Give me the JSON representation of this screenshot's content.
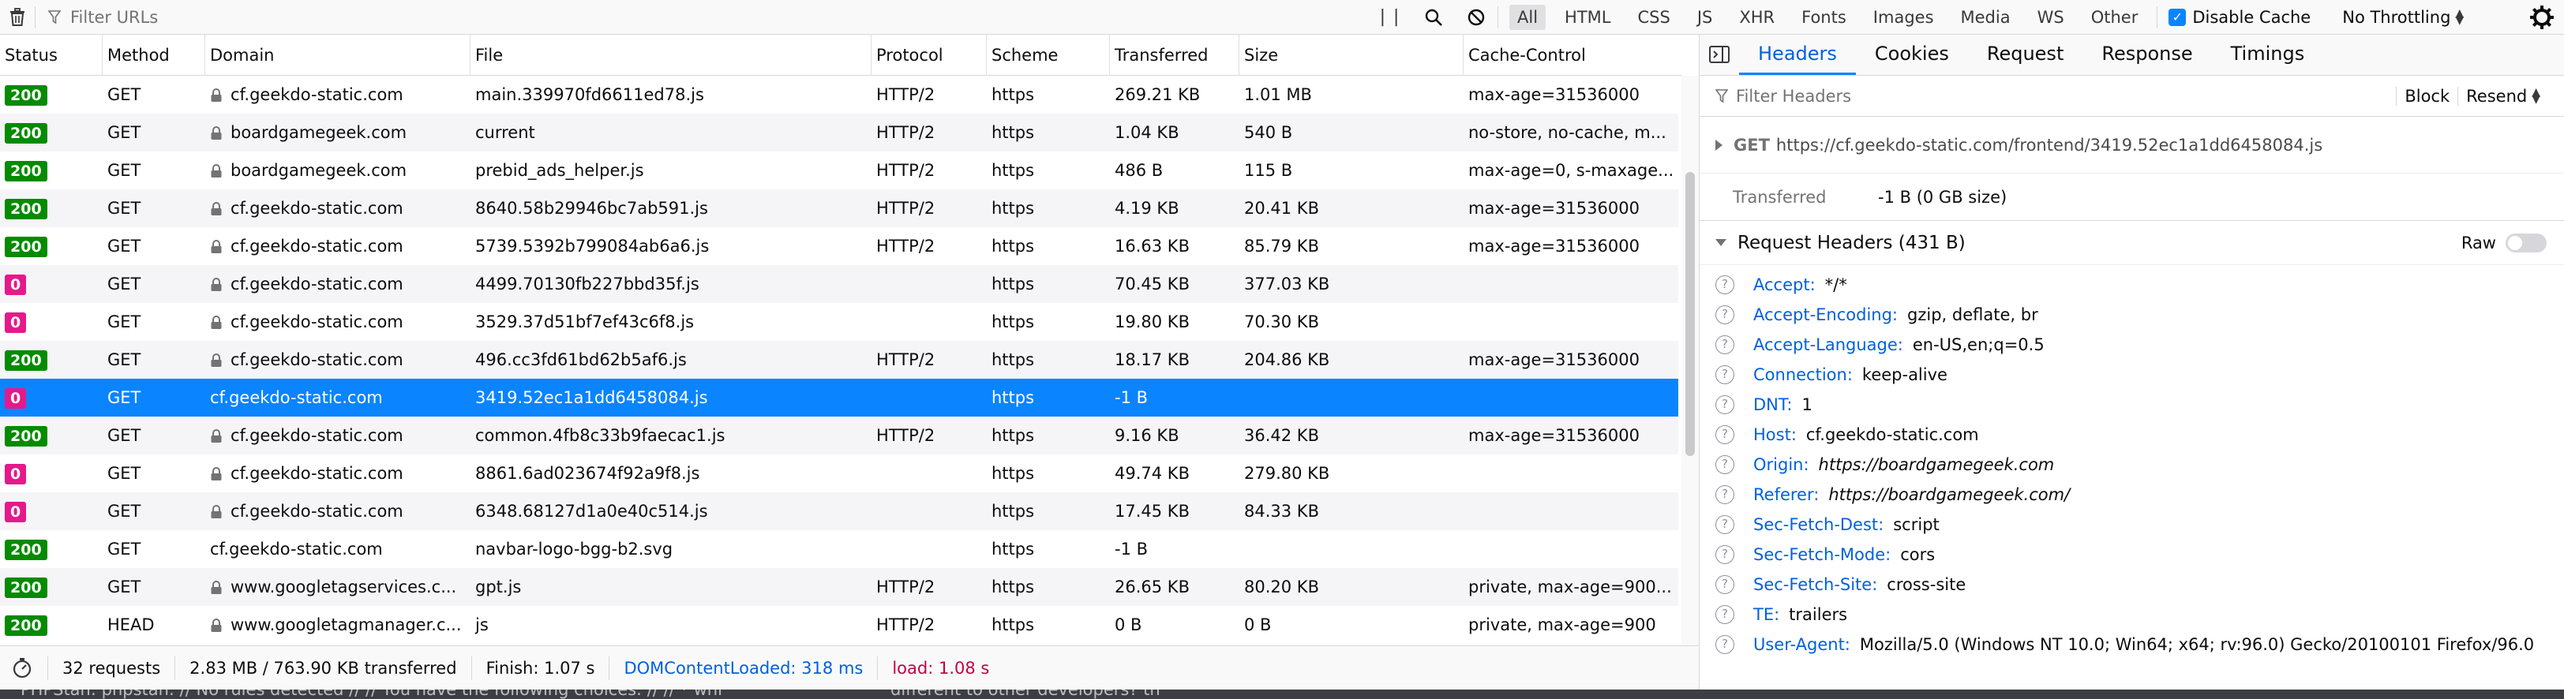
{
  "toolbar": {
    "filter_placeholder": "Filter URLs",
    "type_filters": [
      "All",
      "HTML",
      "CSS",
      "JS",
      "XHR",
      "Fonts",
      "Images",
      "Media",
      "WS",
      "Other"
    ],
    "active_filter": "All",
    "disable_cache_label": "Disable Cache",
    "disable_cache_checked": true,
    "throttling": "No Throttling"
  },
  "columns": [
    "Status",
    "Method",
    "Domain",
    "File",
    "Protocol",
    "Scheme",
    "Transferred",
    "Size",
    "Cache-Control"
  ],
  "requests": [
    {
      "status": "200",
      "method": "GET",
      "secure": true,
      "domain": "cf.geekdo-static.com",
      "file": "main.339970fd6611ed78.js",
      "protocol": "HTTP/2",
      "scheme": "https",
      "transferred": "269.21 KB",
      "size": "1.01 MB",
      "cache": "max-age=31536000"
    },
    {
      "status": "200",
      "method": "GET",
      "secure": true,
      "domain": "boardgamegeek.com",
      "file": "current",
      "protocol": "HTTP/2",
      "scheme": "https",
      "transferred": "1.04 KB",
      "size": "540 B",
      "cache": "no-store, no-cache, m..."
    },
    {
      "status": "200",
      "method": "GET",
      "secure": true,
      "domain": "boardgamegeek.com",
      "file": "prebid_ads_helper.js",
      "protocol": "HTTP/2",
      "scheme": "https",
      "transferred": "486 B",
      "size": "115 B",
      "cache": "max-age=0, s-maxage..."
    },
    {
      "status": "200",
      "method": "GET",
      "secure": true,
      "domain": "cf.geekdo-static.com",
      "file": "8640.58b29946bc7ab591.js",
      "protocol": "HTTP/2",
      "scheme": "https",
      "transferred": "4.19 KB",
      "size": "20.41 KB",
      "cache": "max-age=31536000"
    },
    {
      "status": "200",
      "method": "GET",
      "secure": true,
      "domain": "cf.geekdo-static.com",
      "file": "5739.5392b799084ab6a6.js",
      "protocol": "HTTP/2",
      "scheme": "https",
      "transferred": "16.63 KB",
      "size": "85.79 KB",
      "cache": "max-age=31536000"
    },
    {
      "status": "0",
      "method": "GET",
      "secure": true,
      "domain": "cf.geekdo-static.com",
      "file": "4499.70130fb227bbd35f.js",
      "protocol": "",
      "scheme": "https",
      "transferred": "70.45 KB",
      "size": "377.03 KB",
      "cache": ""
    },
    {
      "status": "0",
      "method": "GET",
      "secure": true,
      "domain": "cf.geekdo-static.com",
      "file": "3529.37d51bf7ef43c6f8.js",
      "protocol": "",
      "scheme": "https",
      "transferred": "19.80 KB",
      "size": "70.30 KB",
      "cache": ""
    },
    {
      "status": "200",
      "method": "GET",
      "secure": true,
      "domain": "cf.geekdo-static.com",
      "file": "496.cc3fd61bd62b5af6.js",
      "protocol": "HTTP/2",
      "scheme": "https",
      "transferred": "18.17 KB",
      "size": "204.86 KB",
      "cache": "max-age=31536000"
    },
    {
      "status": "0",
      "method": "GET",
      "secure": false,
      "domain": "cf.geekdo-static.com",
      "file": "3419.52ec1a1dd6458084.js",
      "protocol": "",
      "scheme": "https",
      "transferred": "-1 B",
      "size": "",
      "cache": "",
      "selected": true
    },
    {
      "status": "200",
      "method": "GET",
      "secure": true,
      "domain": "cf.geekdo-static.com",
      "file": "common.4fb8c33b9faecac1.js",
      "protocol": "HTTP/2",
      "scheme": "https",
      "transferred": "9.16 KB",
      "size": "36.42 KB",
      "cache": "max-age=31536000"
    },
    {
      "status": "0",
      "method": "GET",
      "secure": true,
      "domain": "cf.geekdo-static.com",
      "file": "8861.6ad023674f92a9f8.js",
      "protocol": "",
      "scheme": "https",
      "transferred": "49.74 KB",
      "size": "279.80 KB",
      "cache": ""
    },
    {
      "status": "0",
      "method": "GET",
      "secure": true,
      "domain": "cf.geekdo-static.com",
      "file": "6348.68127d1a0e40c514.js",
      "protocol": "",
      "scheme": "https",
      "transferred": "17.45 KB",
      "size": "84.33 KB",
      "cache": ""
    },
    {
      "status": "200",
      "method": "GET",
      "secure": false,
      "domain": "cf.geekdo-static.com",
      "file": "navbar-logo-bgg-b2.svg",
      "protocol": "",
      "scheme": "https",
      "transferred": "-1 B",
      "size": "",
      "cache": ""
    },
    {
      "status": "200",
      "method": "GET",
      "secure": true,
      "domain": "www.googletagservices.c...",
      "file": "gpt.js",
      "protocol": "HTTP/2",
      "scheme": "https",
      "transferred": "26.65 KB",
      "size": "80.20 KB",
      "cache": "private, max-age=900..."
    },
    {
      "status": "200",
      "method": "HEAD",
      "secure": true,
      "domain": "www.googletagmanager.c...",
      "file": "js",
      "protocol": "HTTP/2",
      "scheme": "https",
      "transferred": "0 B",
      "size": "0 B",
      "cache": "private, max-age=900"
    }
  ],
  "statusbar": {
    "requests": "32 requests",
    "transferred": "2.83 MB / 763.90 KB transferred",
    "finish": "Finish: 1.07 s",
    "dom_content_loaded": "DOMContentLoaded: 318 ms",
    "load": "load: 1.08 s"
  },
  "panel": {
    "tabs": [
      "Headers",
      "Cookies",
      "Request",
      "Response",
      "Timings"
    ],
    "active_tab": "Headers",
    "filter_placeholder": "Filter Headers",
    "block_label": "Block",
    "resend_label": "Resend",
    "request_method": "GET",
    "request_url": "https://cf.geekdo-static.com/frontend/3419.52ec1a1dd6458084.js",
    "transferred_label": "Transferred",
    "transferred_value": "-1 B (0 GB size)",
    "request_headers_title": "Request Headers (431 B)",
    "raw_label": "Raw",
    "headers": [
      {
        "name": "Accept:",
        "value": "*/*"
      },
      {
        "name": "Accept-Encoding:",
        "value": "gzip, deflate, br"
      },
      {
        "name": "Accept-Language:",
        "value": "en-US,en;q=0.5"
      },
      {
        "name": "Connection:",
        "value": "keep-alive"
      },
      {
        "name": "DNT:",
        "value": "1"
      },
      {
        "name": "Host:",
        "value": "cf.geekdo-static.com"
      },
      {
        "name": "Origin:",
        "value": "https://boardgamegeek.com",
        "italic": true
      },
      {
        "name": "Referer:",
        "value": "https://boardgamegeek.com/",
        "italic": true
      },
      {
        "name": "Sec-Fetch-Dest:",
        "value": "script"
      },
      {
        "name": "Sec-Fetch-Mode:",
        "value": "cors"
      },
      {
        "name": "Sec-Fetch-Site:",
        "value": "cross-site"
      },
      {
        "name": "TE:",
        "value": "trailers"
      },
      {
        "name": "User-Agent:",
        "value": "Mozilla/5.0 (Windows NT 10.0; Win64; x64; rv:96.0) Gecko/20100101 Firefox/96.0",
        "wrap": true
      }
    ]
  },
  "background_window": {
    "text_left": "PHPStan: phpstan: // No rules detected // // You have the following choices: // // * whi",
    "text_right": "different to other developers? th"
  },
  "colors": {
    "accent": "#0a84ff",
    "status_ok": "#058b00",
    "status_zero": "#e5198a",
    "link_blue": "#0060df"
  }
}
